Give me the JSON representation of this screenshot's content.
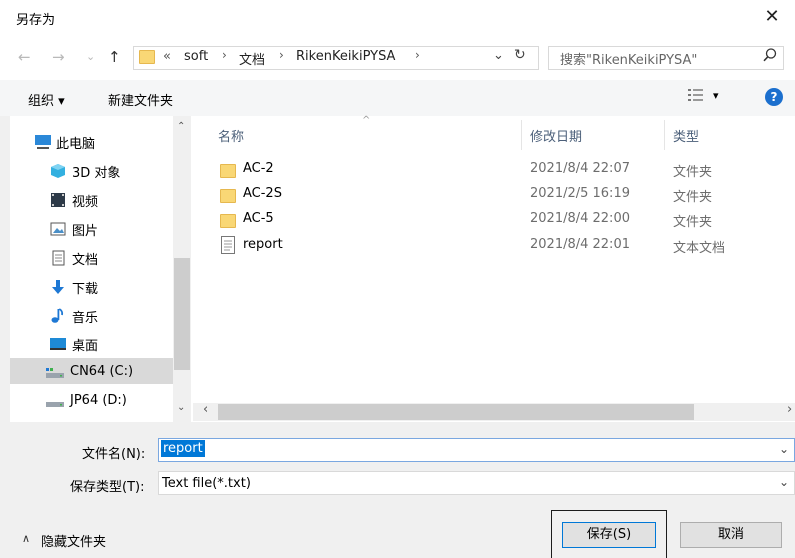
{
  "window": {
    "title": "另存为",
    "close_glyph": "✕"
  },
  "address": {
    "chevron": "«",
    "crumbs": [
      "soft",
      "文档",
      "RikenKeikiPYSA"
    ],
    "sep": "›",
    "dropdown_glyph": "⌄",
    "refresh_glyph": "↻"
  },
  "search": {
    "placeholder": "搜索\"RikenKeikiPYSA\""
  },
  "toolbar": {
    "organize": "组织 ▾",
    "new_folder": "新建文件夹",
    "view_glyph": "▾"
  },
  "sidebar": {
    "items": [
      {
        "label": "此电脑",
        "icon": "computer-icon"
      },
      {
        "label": "3D 对象",
        "icon": "3d-objects-icon"
      },
      {
        "label": "视频",
        "icon": "video-icon"
      },
      {
        "label": "图片",
        "icon": "pictures-icon"
      },
      {
        "label": "文档",
        "icon": "documents-icon"
      },
      {
        "label": "下载",
        "icon": "download-icon"
      },
      {
        "label": "音乐",
        "icon": "music-icon"
      },
      {
        "label": "桌面",
        "icon": "desktop-icon"
      },
      {
        "label": "CN64 (C:)",
        "icon": "drive-icon"
      },
      {
        "label": "JP64 (D:)",
        "icon": "drive-icon"
      }
    ],
    "selected_index": 8
  },
  "filelist": {
    "columns": {
      "name": "名称",
      "modified": "修改日期",
      "type": "类型"
    },
    "rows": [
      {
        "name": "AC-2",
        "modified": "2021/8/4 22:07",
        "type": "文件夹",
        "icon": "folder-icon"
      },
      {
        "name": "AC-2S",
        "modified": "2021/2/5 16:19",
        "type": "文件夹",
        "icon": "folder-icon"
      },
      {
        "name": "AC-5",
        "modified": "2021/8/4 22:00",
        "type": "文件夹",
        "icon": "folder-icon"
      },
      {
        "name": "report",
        "modified": "2021/8/4 22:01",
        "type": "文本文档",
        "icon": "text-file-icon"
      }
    ]
  },
  "form": {
    "filename_label": "文件名(N):",
    "filename_value": "report",
    "filetype_label": "保存类型(T):",
    "filetype_value": "Text file(*.txt)"
  },
  "footer": {
    "hide_folders": "隐藏文件夹",
    "save": "保存(S)",
    "cancel": "取消"
  },
  "colors": {
    "selection": "#0078d7",
    "folder": "#f9d775",
    "help": "#1b6fce"
  }
}
